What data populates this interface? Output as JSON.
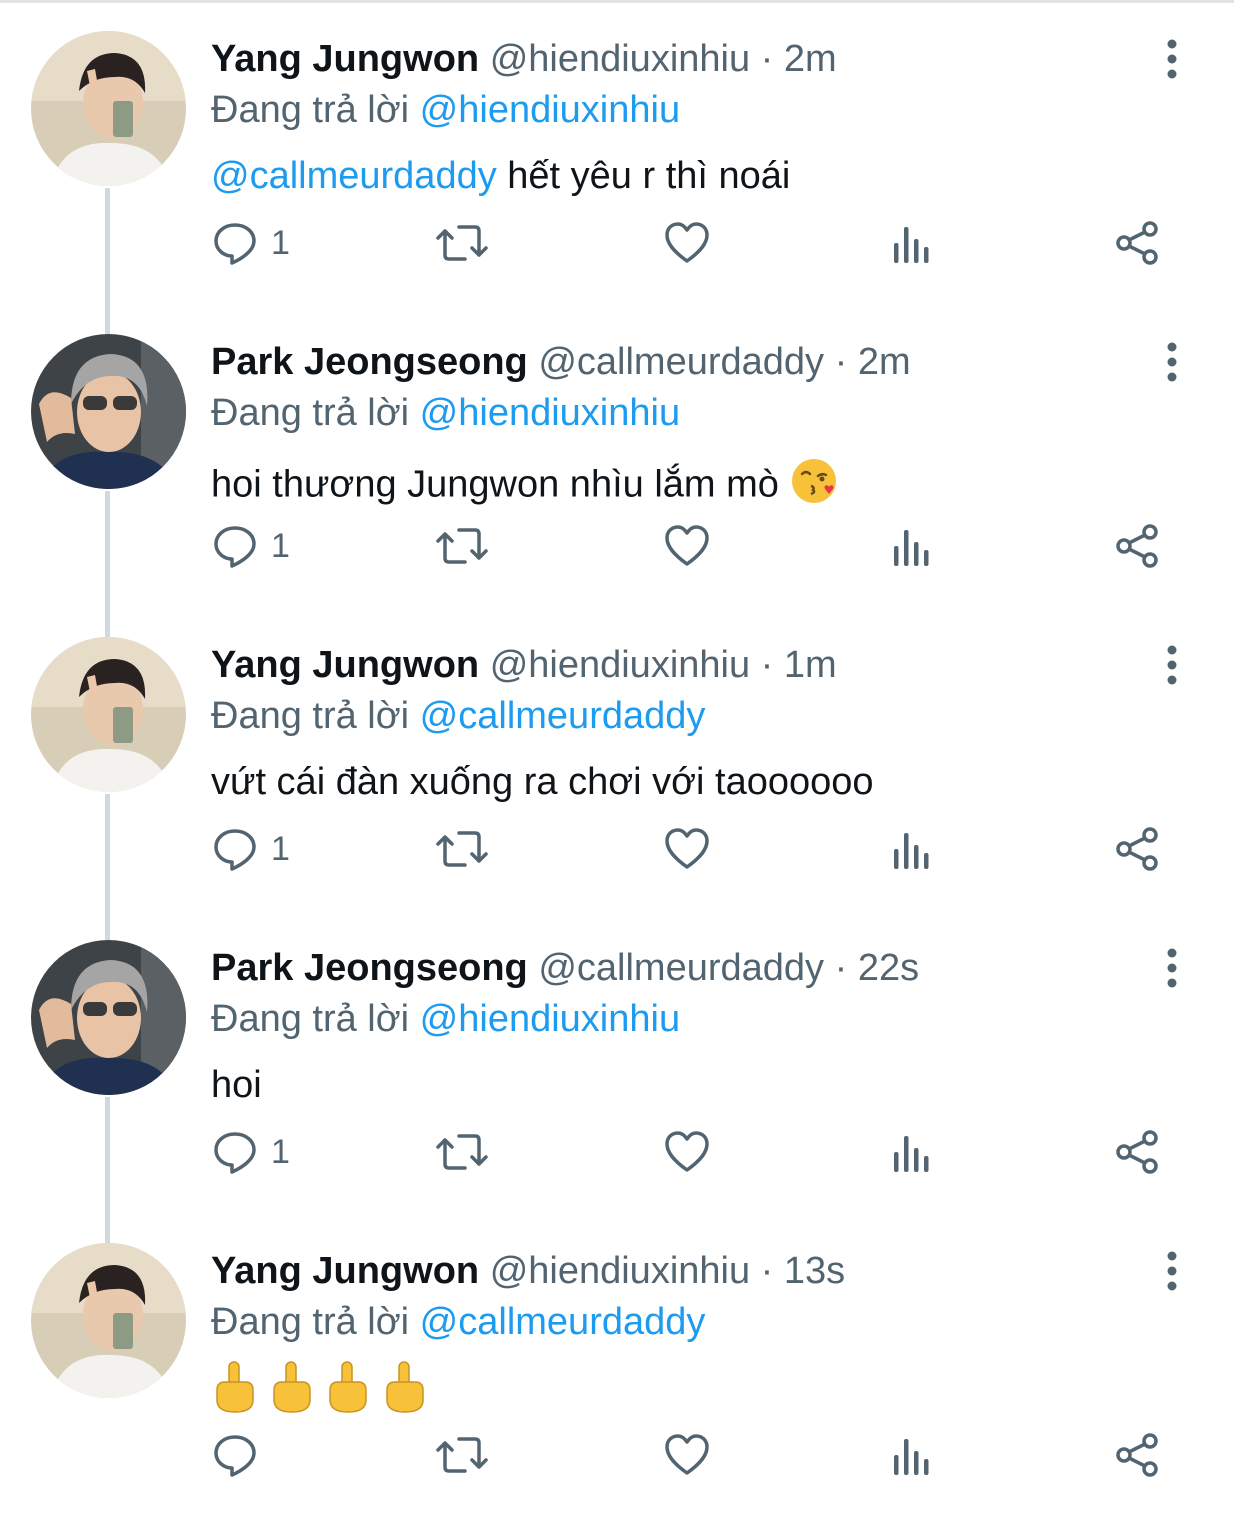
{
  "tweets": [
    {
      "name": "Yang Jungwon",
      "handle": "@hiendiuxinhiu",
      "time": "2m",
      "replying_prefix": "Đang trả lời",
      "replying_to": "@hiendiuxinhiu",
      "body_mention": "@callmeurdaddy",
      "body_text": " hết yêu r thì noái",
      "reply_count": "1",
      "avatar": "jungwon"
    },
    {
      "name": "Park Jeongseong",
      "handle": "@callmeurdaddy",
      "time": "2m",
      "replying_prefix": "Đang trả lời",
      "replying_to": "@hiendiuxinhiu",
      "body_mention": "",
      "body_text": "hoi thương Jungwon nhìu lắm mò",
      "body_emoji": "kiss-emoji",
      "reply_count": "1",
      "avatar": "jeongseong"
    },
    {
      "name": "Yang Jungwon",
      "handle": "@hiendiuxinhiu",
      "time": "1m",
      "replying_prefix": "Đang trả lời",
      "replying_to": "@callmeurdaddy",
      "body_mention": "",
      "body_text": "vứt cái đàn xuống ra chơi với taoooooo",
      "reply_count": "1",
      "avatar": "jungwon"
    },
    {
      "name": "Park Jeongseong",
      "handle": "@callmeurdaddy",
      "time": "22s",
      "replying_prefix": "Đang trả lời",
      "replying_to": "@hiendiuxinhiu",
      "body_mention": "",
      "body_text": "hoi",
      "reply_count": "1",
      "avatar": "jeongseong"
    },
    {
      "name": "Yang Jungwon",
      "handle": "@hiendiuxinhiu",
      "time": "13s",
      "replying_prefix": "Đang trả lời",
      "replying_to": "@callmeurdaddy",
      "body_mention": "",
      "body_text": "",
      "body_emoji": "middle-finger-emoji x4",
      "reply_count": "",
      "avatar": "jungwon"
    }
  ],
  "separator": " · ",
  "colors": {
    "accent": "#1d9bf0",
    "muted": "#536471",
    "text": "#0f1419",
    "thread_line": "#cfd9de"
  }
}
